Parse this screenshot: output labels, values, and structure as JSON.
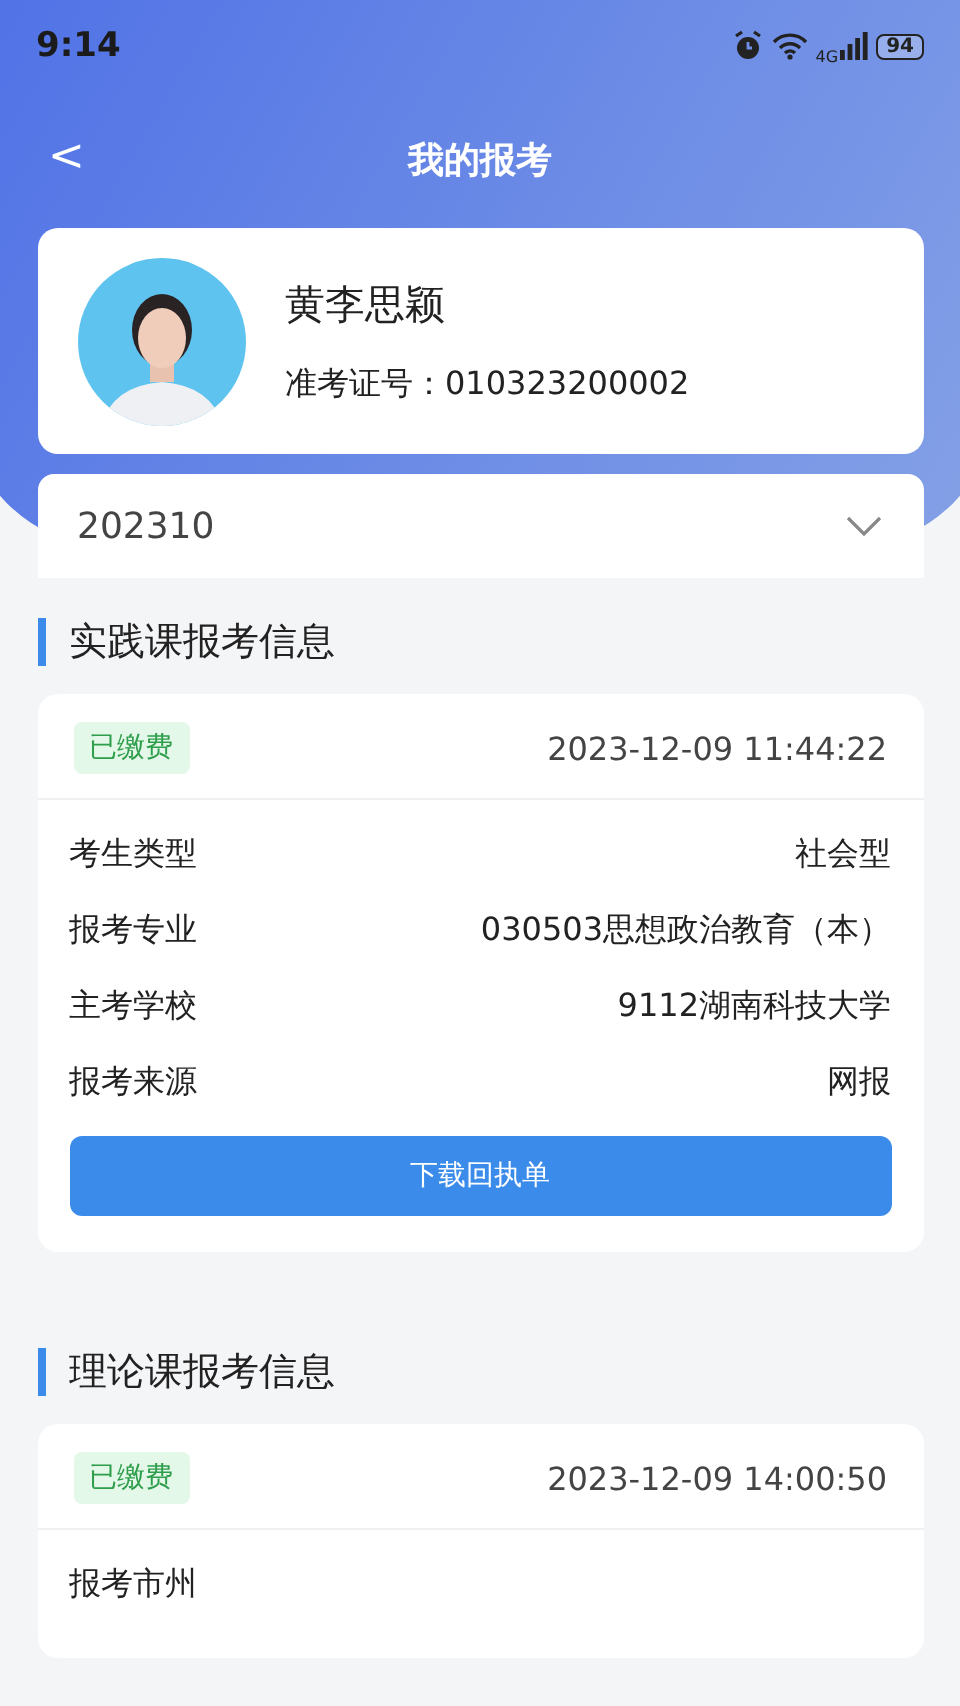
{
  "status_bar": {
    "time": "9:14",
    "network": "4G",
    "battery": "94"
  },
  "header": {
    "back": "<",
    "title": "我的报考"
  },
  "profile": {
    "kind": "picture",
    "name": "黄李思颖",
    "ticket_label": "准考证号：",
    "ticket_number": "010323200002"
  },
  "period_select": {
    "value": "202310"
  },
  "sections": [
    {
      "title": "实践课报考信息",
      "status": "已缴费",
      "time": "2023-12-09 11:44:22",
      "rows": [
        {
          "label": "考生类型",
          "value": "社会型"
        },
        {
          "label": "报考专业",
          "value": "030503思想政治教育（本）"
        },
        {
          "label": "主考学校",
          "value": "9112湖南科技大学"
        },
        {
          "label": "报考来源",
          "value": "网报"
        }
      ],
      "button": "下载回执单"
    },
    {
      "title": "理论课报考信息",
      "status": "已缴费",
      "time": "2023-12-09 14:00:50",
      "rows": [
        {
          "label": "报考市州"
        }
      ]
    }
  ]
}
